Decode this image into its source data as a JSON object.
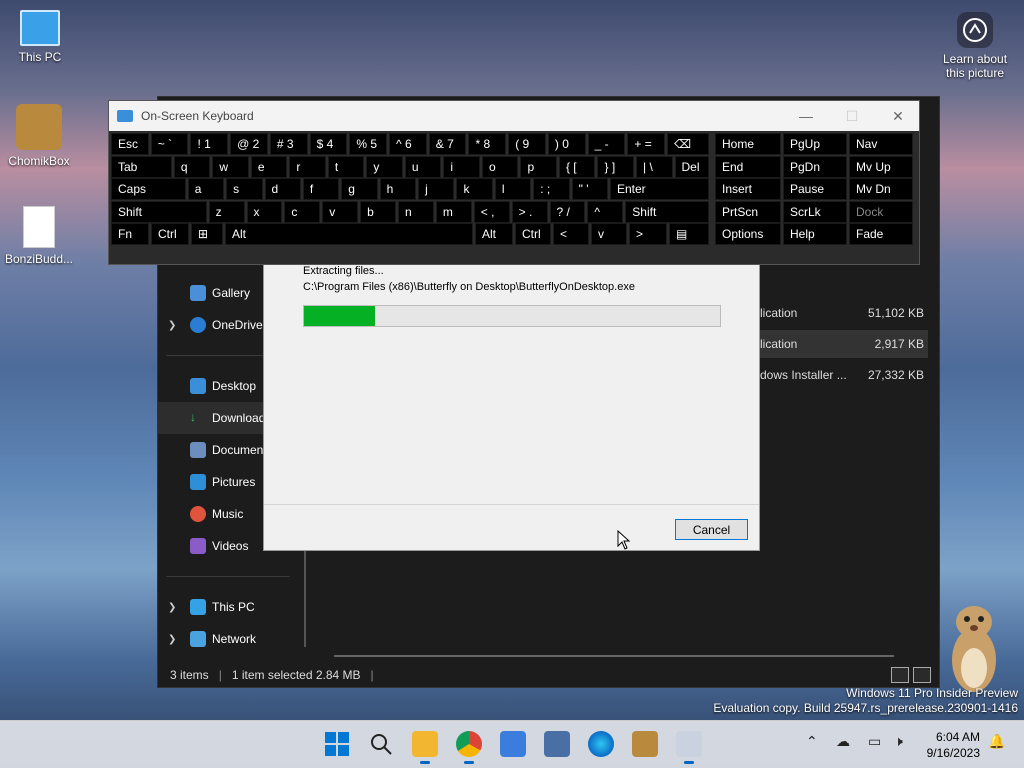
{
  "desktop": {
    "icons": [
      {
        "label": "This PC"
      },
      {
        "label": "ChomikBox"
      },
      {
        "label": "BonziBudd..."
      }
    ],
    "learn_label": "Learn about this picture"
  },
  "explorer": {
    "nav": [
      {
        "label": "Gallery"
      },
      {
        "label": "OneDrive"
      },
      {
        "label": "Desktop"
      },
      {
        "label": "Download"
      },
      {
        "label": "Documen"
      },
      {
        "label": "Pictures"
      },
      {
        "label": "Music"
      },
      {
        "label": "Videos"
      },
      {
        "label": "This PC"
      },
      {
        "label": "Network"
      }
    ],
    "files": [
      {
        "type": "lication",
        "size": "51,102 KB"
      },
      {
        "type": "lication",
        "size": "2,917 KB"
      },
      {
        "type": "dows Installer ...",
        "size": "27,332 KB"
      }
    ],
    "status": {
      "items": "3 items",
      "selected": "1 item selected  2.84 MB"
    }
  },
  "dialog": {
    "line1": "Extracting files...",
    "line2": "C:\\Program Files (x86)\\Butterfly on Desktop\\ButterflyOnDesktop.exe",
    "progress": 0.17,
    "cancel_label": "Cancel"
  },
  "osk": {
    "title": "On-Screen Keyboard",
    "rows": [
      [
        "Esc",
        "~ `",
        "! 1",
        "@ 2",
        "# 3",
        "$ 4",
        "% 5",
        "^ 6",
        "& 7",
        "* 8",
        "( 9",
        ") 0",
        "_ -",
        "+ =",
        "⌫"
      ],
      [
        "Tab",
        "q",
        "w",
        "e",
        "r",
        "t",
        "y",
        "u",
        "i",
        "o",
        "p",
        "{ [",
        "} ]",
        "| \\",
        "Del"
      ],
      [
        "Caps",
        "a",
        "s",
        "d",
        "f",
        "g",
        "h",
        "j",
        "k",
        "l",
        ": ;",
        "\" '",
        "Enter"
      ],
      [
        "Shift",
        "z",
        "x",
        "c",
        "v",
        "b",
        "n",
        "m",
        "< ,",
        "> .",
        "? /",
        "^",
        "Shift"
      ],
      [
        "Fn",
        "Ctrl",
        "⊞",
        "Alt",
        "Alt",
        "Ctrl",
        "<",
        "v",
        ">",
        "▤"
      ]
    ],
    "right_keys": [
      [
        "Home",
        "PgUp",
        "Nav"
      ],
      [
        "End",
        "PgDn",
        "Mv Up"
      ],
      [
        "Insert",
        "Pause",
        "Mv Dn"
      ],
      [
        "PrtScn",
        "ScrLk",
        "Dock"
      ],
      [
        "Options",
        "Help",
        "Fade"
      ]
    ]
  },
  "watermark": {
    "line1": "Windows 11 Pro Insider Preview",
    "line2": "Evaluation copy. Build 25947.rs_prerelease.230901-1416"
  },
  "clock": {
    "time": "6:04 AM",
    "date": "9/16/2023"
  },
  "colors": {
    "progress": "#06b025",
    "accent": "#0078d7"
  }
}
